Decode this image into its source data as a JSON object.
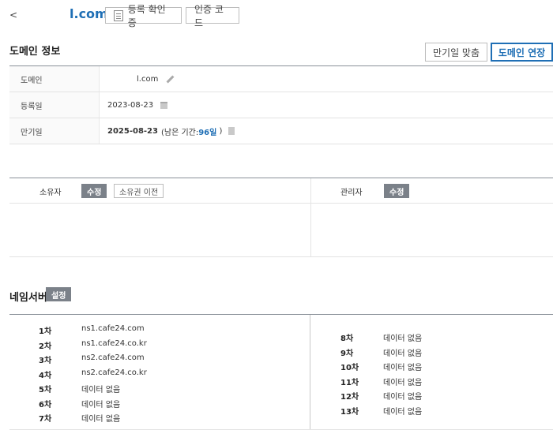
{
  "header": {
    "back_label": "<",
    "domain": "l.com",
    "cert_button": "등록 확인증",
    "auth_button": "인증 코드"
  },
  "domain_info": {
    "title": "도메인 정보",
    "match_button": "만기일 맞춤",
    "extend_button": "도메인 연장",
    "rows": [
      {
        "label": "도메인",
        "value": "l.com"
      },
      {
        "label": "등록일",
        "value": "2023-08-23"
      },
      {
        "label": "만기일",
        "value": "2025-08-23",
        "remaining_prefix": "(남은 기간: ",
        "remaining_days": "96일",
        "remaining_suffix": ")"
      }
    ]
  },
  "contacts": {
    "owner_label": "소유자",
    "owner_edit": "수정",
    "owner_transfer": "소유권 이전",
    "admin_label": "관리자",
    "admin_edit": "수정"
  },
  "nameservers": {
    "title": "네임서버",
    "setting_button": "설정",
    "left": [
      {
        "order": "1차",
        "value": "ns1.cafe24.com"
      },
      {
        "order": "2차",
        "value": "ns1.cafe24.co.kr"
      },
      {
        "order": "3차",
        "value": "ns2.cafe24.com"
      },
      {
        "order": "4차",
        "value": "ns2.cafe24.co.kr"
      },
      {
        "order": "5차",
        "value": "데이터 없음"
      },
      {
        "order": "6차",
        "value": "데이터 없음"
      },
      {
        "order": "7차",
        "value": "데이터 없음"
      }
    ],
    "right": [
      {
        "order": "8차",
        "value": "데이터 없음"
      },
      {
        "order": "9차",
        "value": "데이터 없음"
      },
      {
        "order": "10차",
        "value": "데이터 없음"
      },
      {
        "order": "11차",
        "value": "데이터 없음"
      },
      {
        "order": "12차",
        "value": "데이터 없음"
      },
      {
        "order": "13차",
        "value": "데이터 없음"
      }
    ]
  },
  "colors": {
    "accent": "#1f6fb5",
    "gray_button": "#7b8189"
  }
}
